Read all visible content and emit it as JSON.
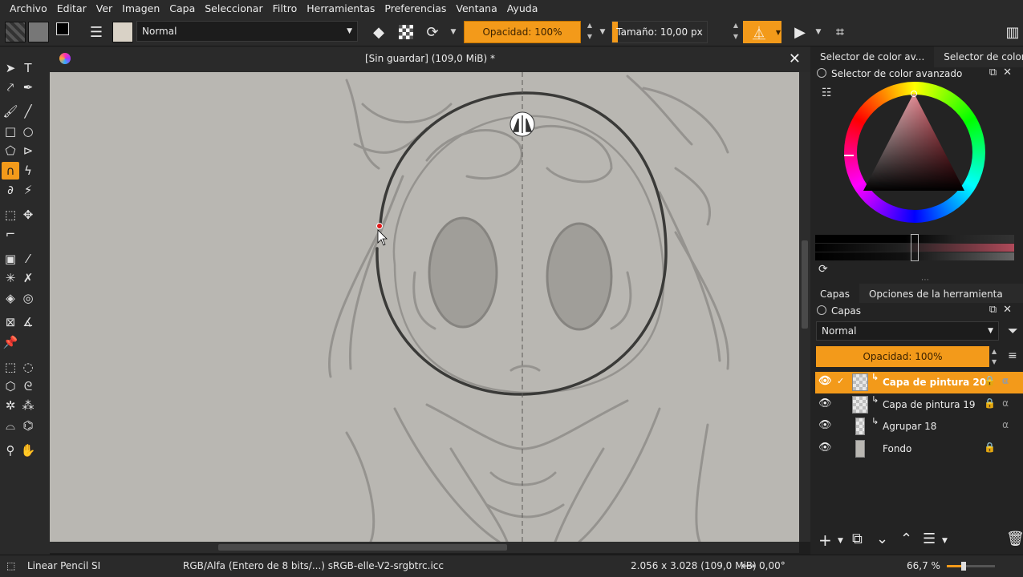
{
  "menu": [
    "Archivo",
    "Editar",
    "Ver",
    "Imagen",
    "Capa",
    "Seleccionar",
    "Filtro",
    "Herramientas",
    "Preferencias",
    "Ventana",
    "Ayuda"
  ],
  "toolbar": {
    "blend_mode": "Normal",
    "opacity_label": "Opacidad: 100%",
    "size_label": "Tamaño: 10,00 px",
    "size_fill": 0.06
  },
  "document": {
    "title": "[Sin guardar]  (109,0 MiB) *"
  },
  "statusbar": {
    "tool": "Linear Pencil SI",
    "color_space": "RGB/Alfa (Entero de 8 bits/...)  sRGB-elle-V2-srgbtrc.icc",
    "dimensions": "2.056 x 3.028 (109,0 MiB)",
    "rotation": "0,00°",
    "zoom": "66,7 %"
  },
  "color_docker": {
    "tabs": [
      "Selector de color av...",
      "Selector de color esp..."
    ],
    "title": "Selector de color avanzado"
  },
  "layers_docker": {
    "tabs": [
      "Capas",
      "Opciones de la herramienta"
    ],
    "title": "Capas",
    "blend_mode": "Normal",
    "opacity_label": "Opacidad:  100%",
    "layers": [
      {
        "name": "Capa de pintura 20",
        "selected": true
      },
      {
        "name": "Capa de pintura 19",
        "selected": false
      },
      {
        "name": "Agrupar 18",
        "selected": false
      },
      {
        "name": "Fondo",
        "selected": false
      }
    ]
  }
}
